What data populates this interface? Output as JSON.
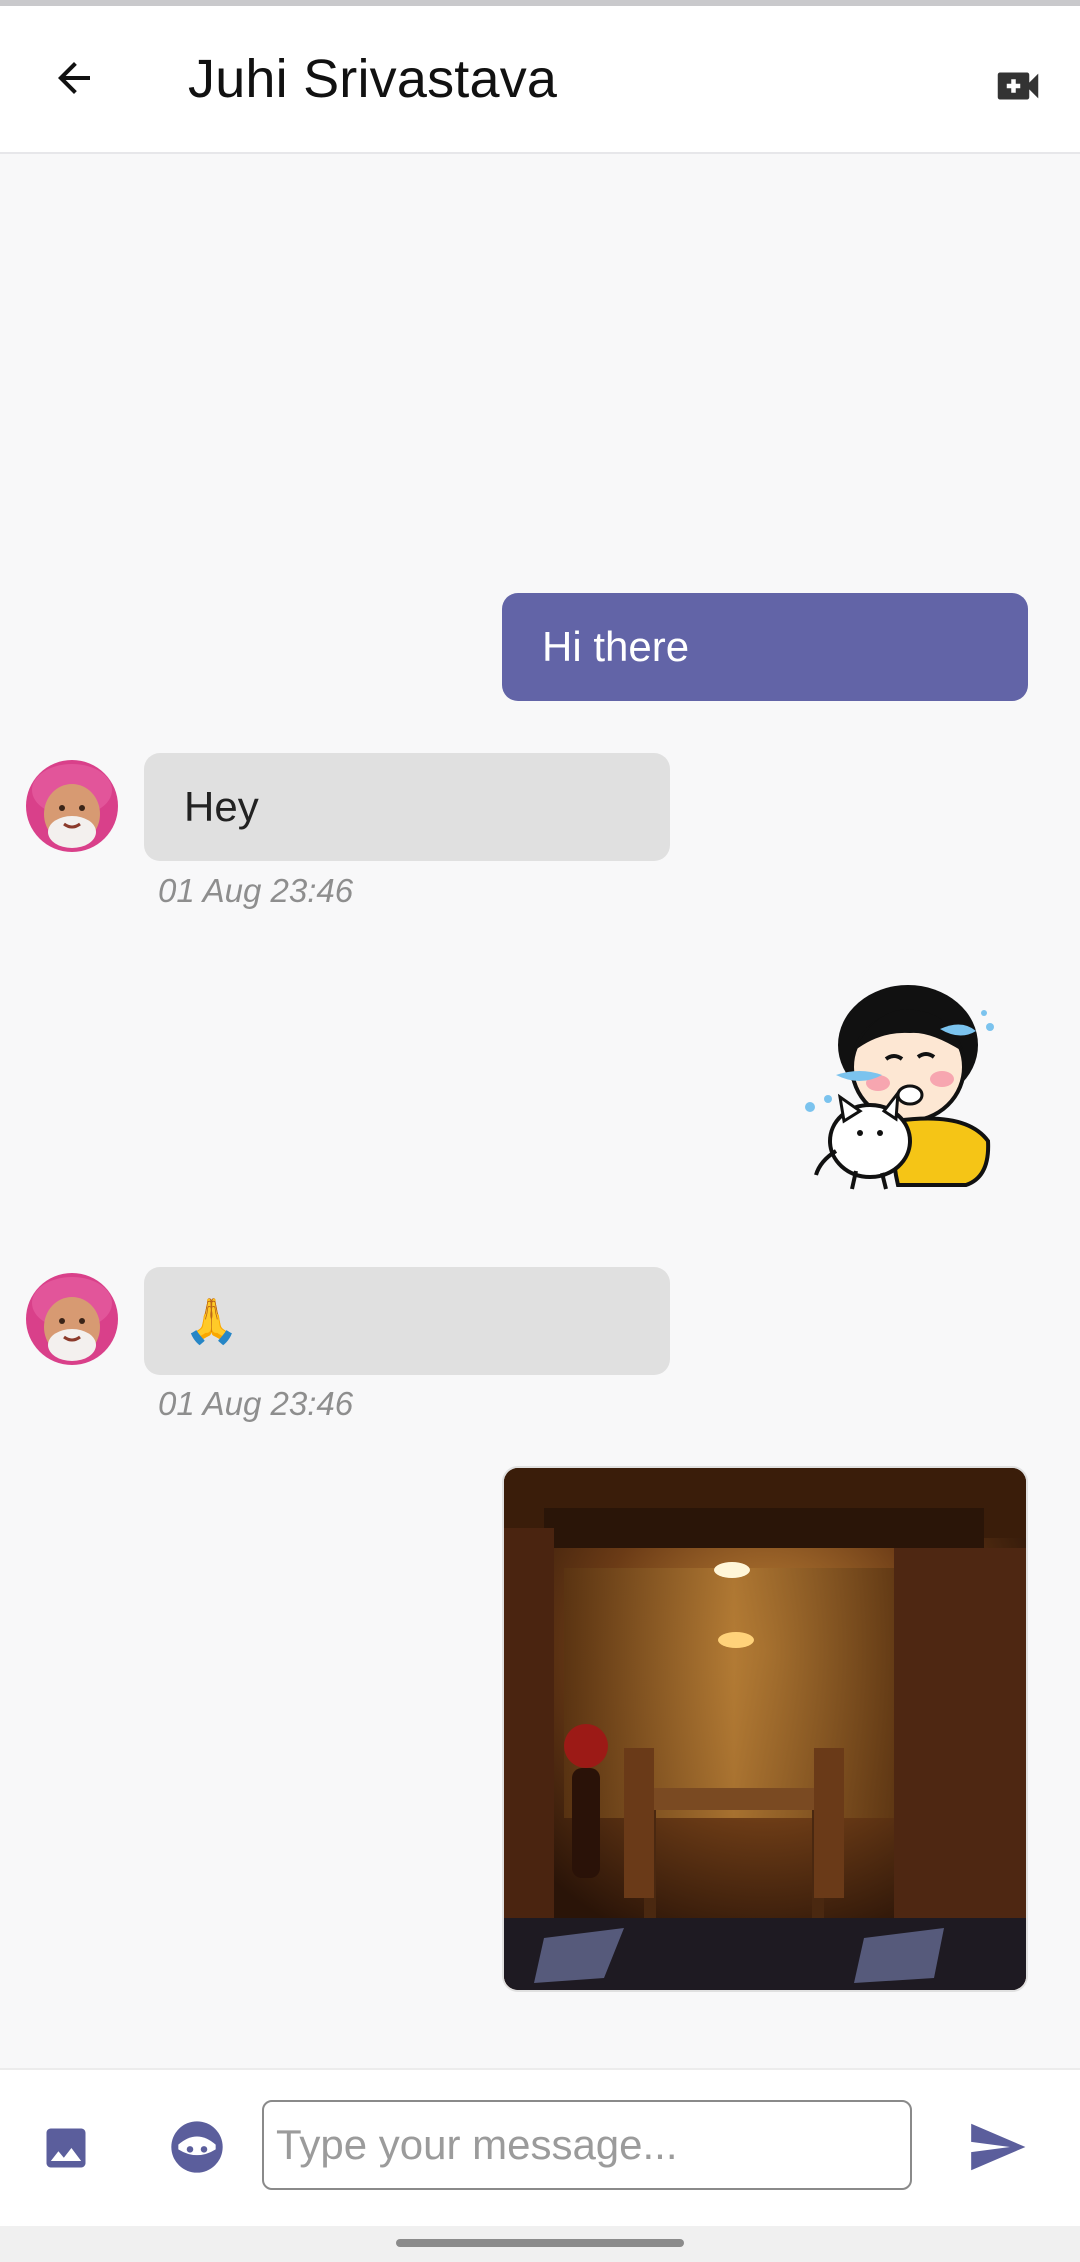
{
  "header": {
    "title": "Juhi Srivastava",
    "back_icon": "arrow-left-icon",
    "video_icon": "video-call-icon"
  },
  "messages": [
    {
      "type": "text",
      "direction": "sent",
      "text": "Hi there"
    },
    {
      "type": "text",
      "direction": "received",
      "text": "Hey",
      "time": "01 Aug 23:46"
    },
    {
      "type": "sticker",
      "direction": "sent",
      "sticker": "crying-girl-hugging-cat-sticker"
    },
    {
      "type": "text",
      "direction": "received",
      "text": "🙏",
      "time": "01 Aug 23:46"
    },
    {
      "type": "image",
      "direction": "sent",
      "image": "dining-room-photo"
    }
  ],
  "composer": {
    "placeholder": "Type your message...",
    "value": "",
    "image_icon": "image-icon",
    "emoji_icon": "emoji-icon",
    "send_icon": "send-icon"
  },
  "colors": {
    "accent": "#6264a7",
    "received_bubble": "#e0e0e0",
    "background": "#f8f8f9"
  }
}
